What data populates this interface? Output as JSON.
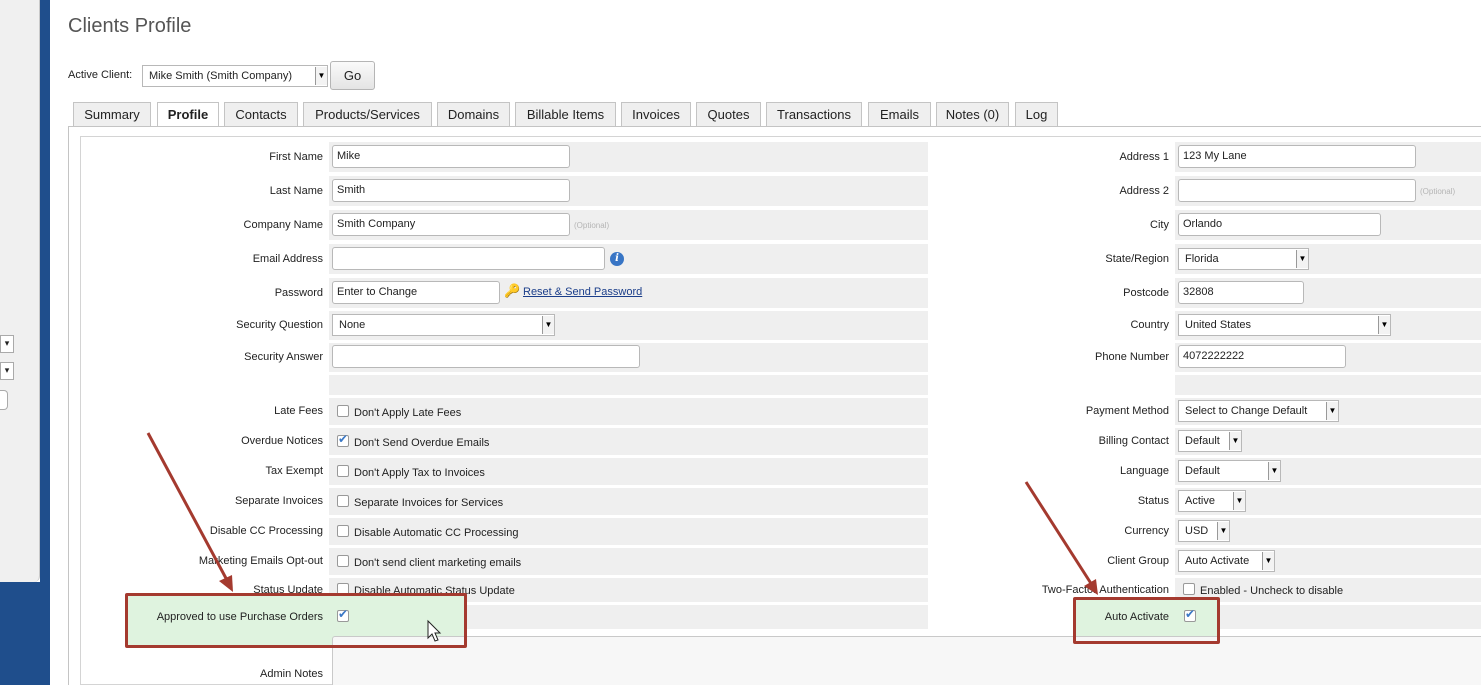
{
  "page": {
    "title": "Clients Profile"
  },
  "active_client": {
    "label": "Active Client:",
    "value": "Mike Smith (Smith Company)",
    "go_label": "Go"
  },
  "tabs": [
    "Summary",
    "Profile",
    "Contacts",
    "Products/Services",
    "Domains",
    "Billable Items",
    "Invoices",
    "Quotes",
    "Transactions",
    "Emails",
    "Notes (0)",
    "Log"
  ],
  "active_tab": "Profile",
  "left": {
    "first_name": {
      "label": "First Name",
      "value": "Mike"
    },
    "last_name": {
      "label": "Last Name",
      "value": "Smith"
    },
    "company_name": {
      "label": "Company Name",
      "value": "Smith Company",
      "hint": "(Optional)"
    },
    "email": {
      "label": "Email Address",
      "value": ""
    },
    "password": {
      "label": "Password",
      "value": "Enter to Change",
      "link": "Reset & Send Password"
    },
    "security_question": {
      "label": "Security Question",
      "value": "None"
    },
    "security_answer": {
      "label": "Security Answer",
      "value": ""
    },
    "late_fees": {
      "label": "Late Fees",
      "text": "Don't Apply Late Fees",
      "checked": false
    },
    "overdue_notices": {
      "label": "Overdue Notices",
      "text": "Don't Send Overdue Emails",
      "checked": true
    },
    "tax_exempt": {
      "label": "Tax Exempt",
      "text": "Don't Apply Tax to Invoices",
      "checked": false
    },
    "separate_invoices": {
      "label": "Separate Invoices",
      "text": "Separate Invoices for Services",
      "checked": false
    },
    "disable_cc": {
      "label": "Disable CC Processing",
      "text": "Disable Automatic CC Processing",
      "checked": false
    },
    "marketing_optout": {
      "label": "Marketing Emails Opt-out",
      "text": "Don't send client marketing emails",
      "checked": false
    },
    "status_update": {
      "label": "Status Update",
      "text": "Disable Automatic Status Update",
      "checked": false
    },
    "purchase_orders": {
      "label": "Approved to use Purchase Orders",
      "checked": true
    },
    "admin_notes": {
      "label": "Admin Notes"
    }
  },
  "right": {
    "address1": {
      "label": "Address 1",
      "value": "123 My Lane"
    },
    "address2": {
      "label": "Address 2",
      "value": "",
      "hint": "(Optional)"
    },
    "city": {
      "label": "City",
      "value": "Orlando"
    },
    "state": {
      "label": "State/Region",
      "value": "Florida"
    },
    "postcode": {
      "label": "Postcode",
      "value": "32808"
    },
    "country": {
      "label": "Country",
      "value": "United States"
    },
    "phone": {
      "label": "Phone Number",
      "value": "4072222222"
    },
    "payment_method": {
      "label": "Payment Method",
      "value": "Select to Change Default"
    },
    "billing_contact": {
      "label": "Billing Contact",
      "value": "Default"
    },
    "language": {
      "label": "Language",
      "value": "Default"
    },
    "status": {
      "label": "Status",
      "value": "Active"
    },
    "currency": {
      "label": "Currency",
      "value": "USD"
    },
    "client_group": {
      "label": "Client Group",
      "value": "Auto Activate"
    },
    "two_factor": {
      "label": "Two-Factor Authentication",
      "text": "Enabled - Uncheck to disable",
      "checked": false
    },
    "auto_activate": {
      "label": "Auto Activate",
      "checked": true
    }
  },
  "annotation_color": "#a43a2f",
  "highlight_color": "#dff3df"
}
